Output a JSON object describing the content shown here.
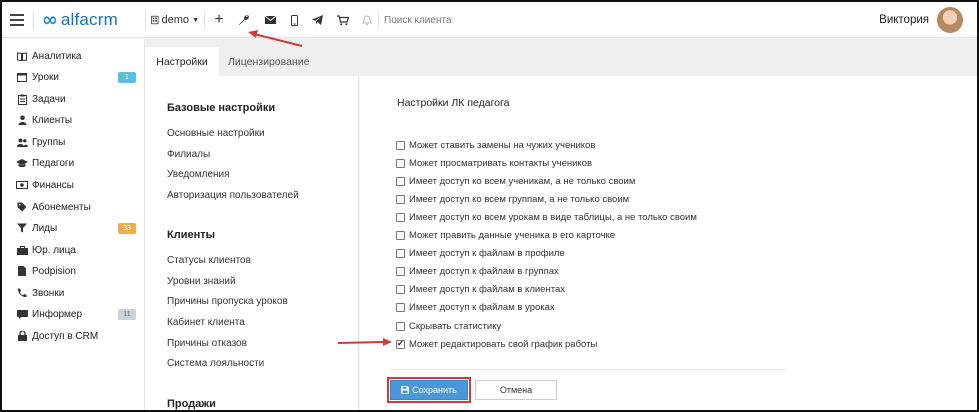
{
  "topbar": {
    "logo_mark": "∞",
    "logo_text": "alfacrm",
    "branch": "demo",
    "search_placeholder": "Поиск клиента",
    "user_name": "Виктория"
  },
  "sidebar": {
    "items": [
      {
        "label": "Аналитика",
        "icon": "book-icon"
      },
      {
        "label": "Уроки",
        "icon": "calendar-icon",
        "badge": "1"
      },
      {
        "label": "Задачи",
        "icon": "clipboard-icon"
      },
      {
        "label": "Клиенты",
        "icon": "user-icon"
      },
      {
        "label": "Группы",
        "icon": "users-icon"
      },
      {
        "label": "Педагоги",
        "icon": "graduation-cap-icon"
      },
      {
        "label": "Финансы",
        "icon": "money-icon"
      },
      {
        "label": "Абонементы",
        "icon": "tag-icon"
      },
      {
        "label": "Лиды",
        "icon": "funnel-icon",
        "badge": "33"
      },
      {
        "label": "Юр. лица",
        "icon": "briefcase-icon"
      },
      {
        "label": "Podpision",
        "icon": "document-icon"
      },
      {
        "label": "Звонки",
        "icon": "phone-icon"
      },
      {
        "label": "Информер",
        "icon": "chat-icon",
        "badge": "11"
      },
      {
        "label": "Доступ в CRM",
        "icon": "lock-icon"
      }
    ],
    "badge_colors": {
      "blue": "#5bc0de",
      "orange": "#f0ad4e",
      "gray": "#c9d3d8"
    }
  },
  "tabs": [
    "Настройки",
    "Лицензирование"
  ],
  "left": {
    "basic_title": "Базовые настройки",
    "basic_links": [
      "Основные настройки",
      "Филиалы",
      "Уведомления",
      "Авторизация пользователей"
    ],
    "clients_title": "Клиенты",
    "client_links": [
      "Статусы клиентов",
      "Уровни знаний",
      "Причины пропуска уроков",
      "Кабинет клиента",
      "Причины отказов",
      "Система лояльности"
    ],
    "sales_title": "Продажи"
  },
  "panel": {
    "title": "Настройки ЛК педагога",
    "options": [
      {
        "label": "Может ставить замены на чужих учеников",
        "checked": false
      },
      {
        "label": "Может просматривать контакты учеников",
        "checked": false
      },
      {
        "label": "Имеет доступ ко всем ученикам, а не только своим",
        "checked": false
      },
      {
        "label": "Имеет доступ ко всем группам, а не только своим",
        "checked": false
      },
      {
        "label": "Имеет доступ ко всем урокам в виде таблицы, а не только своим",
        "checked": false
      },
      {
        "label": "Может править данные ученика в его карточке",
        "checked": false
      },
      {
        "label": "Имеет доступ к файлам в профиле",
        "checked": false
      },
      {
        "label": "Имеет доступ к файлам в группах",
        "checked": false
      },
      {
        "label": "Имеет доступ к файлам в клиентах",
        "checked": false
      },
      {
        "label": "Имеет доступ к файлам в уроках",
        "checked": false
      },
      {
        "label": "Скрывать статистику",
        "checked": false
      },
      {
        "label": "Может редактировать свой график работы",
        "checked": true
      }
    ],
    "save_label": "Сохранить",
    "cancel_label": "Отмена"
  },
  "colors": {
    "brand_blue": "#1b6fbf",
    "save_button": "#4a97d9",
    "annotation_red": "#d23a3a"
  }
}
